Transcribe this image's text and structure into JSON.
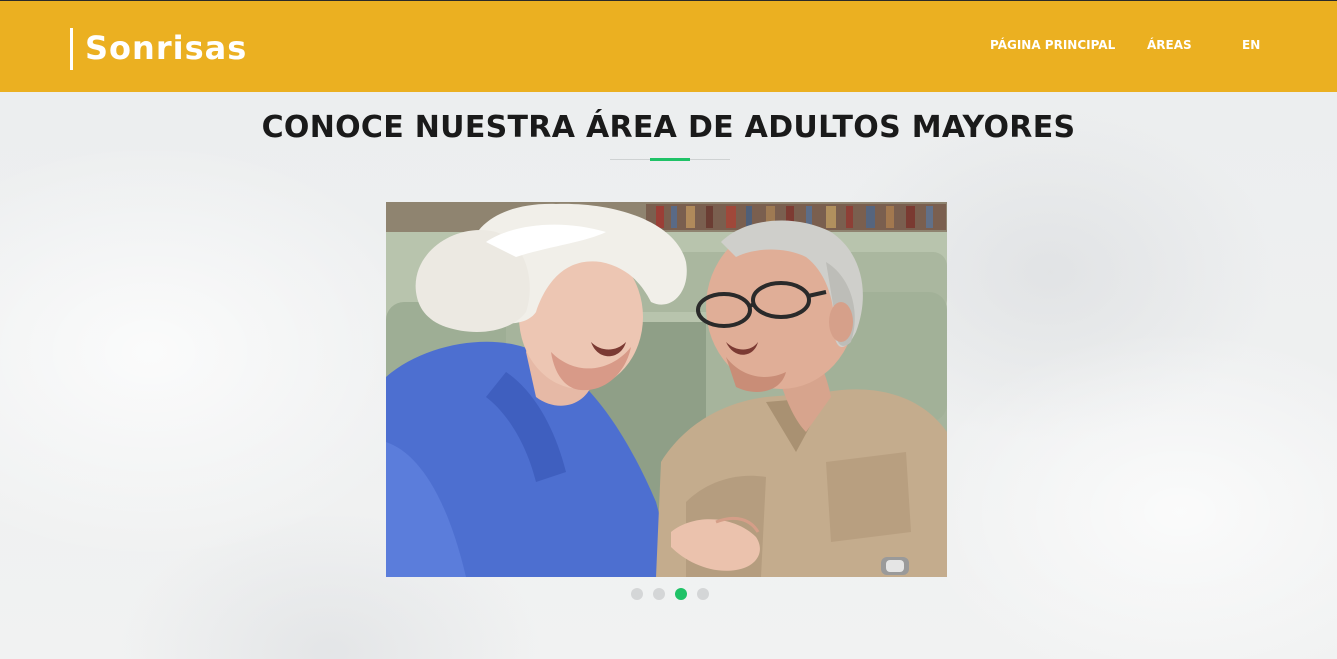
{
  "header": {
    "brand": "Sonrisas",
    "nav": [
      {
        "label": "PÁGINA PRINCIPAL"
      },
      {
        "label": "ÁREAS"
      },
      {
        "label": "EN"
      }
    ],
    "background_color": "#ebb021"
  },
  "section": {
    "title": "CONOCE NUESTRA ÁREA DE ADULTOS MAYORES",
    "accent_color": "#1fc267"
  },
  "carousel": {
    "image_icon": "elderly-couple-photo",
    "slide_count": 4,
    "active_index": 2
  }
}
